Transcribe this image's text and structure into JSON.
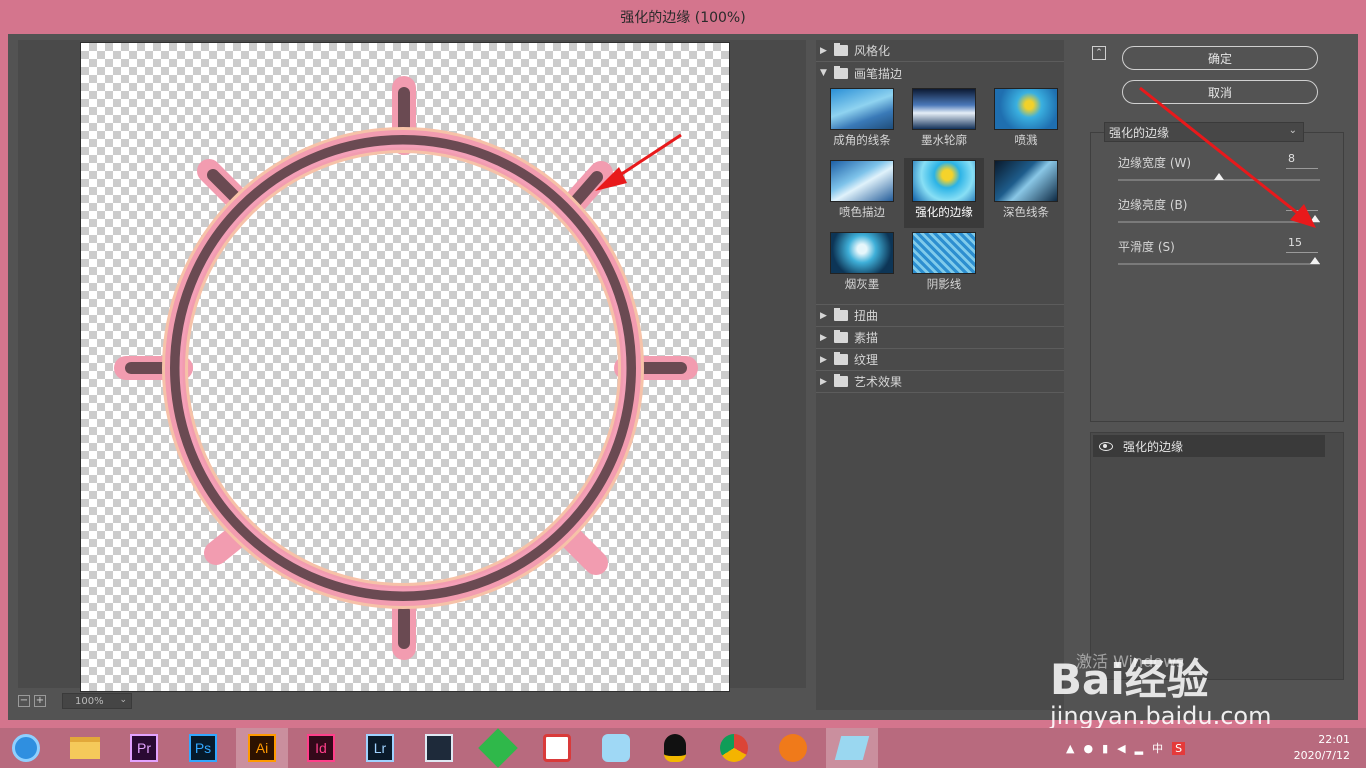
{
  "window": {
    "title": "强化的边缘 (100%)"
  },
  "preview": {
    "zoom": "100%",
    "zoom_out": "−",
    "zoom_in": "+"
  },
  "gallery": {
    "folders_top": [
      {
        "label": "风格化",
        "expanded": false
      },
      {
        "label": "画笔描边",
        "expanded": true
      }
    ],
    "thumbs": [
      {
        "label": "成角的线条",
        "selected": false
      },
      {
        "label": "墨水轮廓",
        "selected": false
      },
      {
        "label": "喷溅",
        "selected": false
      },
      {
        "label": "喷色描边",
        "selected": false
      },
      {
        "label": "强化的边缘",
        "selected": true
      },
      {
        "label": "深色线条",
        "selected": false
      },
      {
        "label": "烟灰墨",
        "selected": false
      },
      {
        "label": "阴影线",
        "selected": false
      }
    ],
    "folders_bottom": [
      {
        "label": "扭曲"
      },
      {
        "label": "素描"
      },
      {
        "label": "纹理"
      },
      {
        "label": "艺术效果"
      }
    ]
  },
  "settings": {
    "ok_label": "确定",
    "cancel_label": "取消",
    "collapse_glyph": "⌃",
    "filter_select": "强化的边缘",
    "params": [
      {
        "label": "边缘宽度 (W)",
        "value": "8",
        "fraction": 0.5
      },
      {
        "label": "边缘亮度 (B)",
        "value": "",
        "fraction": 1.0
      },
      {
        "label": "平滑度 (S)",
        "value": "15",
        "fraction": 1.0
      }
    ],
    "layer": {
      "label": "强化的边缘"
    }
  },
  "taskbar": {
    "apps": [
      "Pr",
      "Ps",
      "Ai",
      "Id",
      "Lr"
    ],
    "tray": [
      "中",
      "S"
    ],
    "time": "22:01",
    "date": "2020/7/12"
  },
  "watermark": {
    "activate": "激活 Windows",
    "brand": "Bai经验",
    "url": "jingyan.baidu.com"
  },
  "colors": {
    "ring_dark": "#6a4a52",
    "ring_pink": "#f29cb0",
    "arrow_red": "#e8191b",
    "frame_pink": "#d4758d"
  }
}
